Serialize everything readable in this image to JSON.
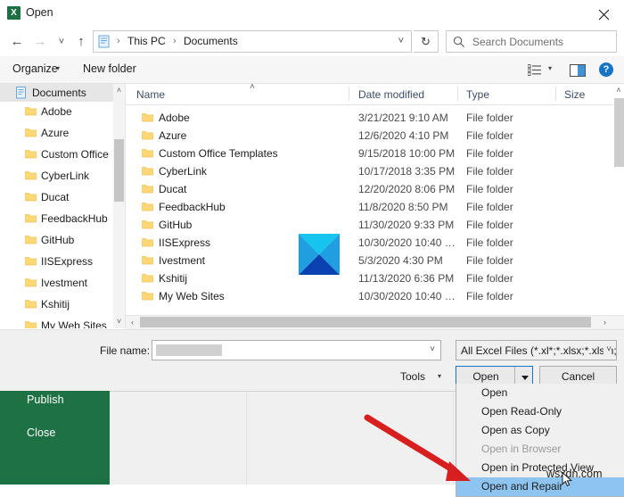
{
  "window": {
    "title": "Open",
    "app_icon": "excel-icon",
    "close_icon": "close-icon"
  },
  "nav": {
    "back_icon": "back-arrow-icon",
    "forward_icon": "forward-arrow-icon",
    "recent_icon": "recent-locations-chevron-icon",
    "up_icon": "up-arrow-icon",
    "breadcrumbs": [
      "This PC",
      "Documents"
    ],
    "separator": "›",
    "address_chevron": "chevron-down-icon",
    "refresh_icon": "refresh-icon"
  },
  "search": {
    "placeholder": "Search Documents",
    "icon": "search-icon"
  },
  "commandbar": {
    "organize_label": "Organize",
    "organize_caret": "▾",
    "new_folder_label": "New folder",
    "view_icon": "view-layout-icon",
    "view_caret": "▾",
    "preview_pane_icon": "preview-pane-icon",
    "help_icon": "help-icon"
  },
  "navpane": {
    "root": {
      "label": "Documents",
      "icon": "documents-folder-icon"
    },
    "items": [
      {
        "label": "Adobe"
      },
      {
        "label": "Azure"
      },
      {
        "label": "Custom Office"
      },
      {
        "label": "CyberLink"
      },
      {
        "label": "Ducat"
      },
      {
        "label": "FeedbackHub"
      },
      {
        "label": "GitHub"
      },
      {
        "label": "IISExpress"
      },
      {
        "label": "Ivestment"
      },
      {
        "label": "Kshitij"
      },
      {
        "label": "My Web Sites"
      }
    ],
    "scroll_up_icon": "chevron-up-icon",
    "scroll_down_icon": "chevron-down-icon"
  },
  "filelist": {
    "columns": [
      "Name",
      "Date modified",
      "Type",
      "Size"
    ],
    "sort_indicator": "˄",
    "rows": [
      {
        "name": "Adobe",
        "date": "3/21/2021 9:10 AM",
        "type": "File folder",
        "size": ""
      },
      {
        "name": "Azure",
        "date": "12/6/2020 4:10 PM",
        "type": "File folder",
        "size": ""
      },
      {
        "name": "Custom Office Templates",
        "date": "9/15/2018 10:00 PM",
        "type": "File folder",
        "size": ""
      },
      {
        "name": "CyberLink",
        "date": "10/17/2018 3:35 PM",
        "type": "File folder",
        "size": ""
      },
      {
        "name": "Ducat",
        "date": "12/20/2020 8:06 PM",
        "type": "File folder",
        "size": ""
      },
      {
        "name": "FeedbackHub",
        "date": "11/8/2020 8:50 PM",
        "type": "File folder",
        "size": ""
      },
      {
        "name": "GitHub",
        "date": "11/30/2020 9:33 PM",
        "type": "File folder",
        "size": ""
      },
      {
        "name": "IISExpress",
        "date": "10/30/2020 10:40 …",
        "type": "File folder",
        "size": ""
      },
      {
        "name": "Ivestment",
        "date": "5/3/2020 4:30 PM",
        "type": "File folder",
        "size": ""
      },
      {
        "name": "Kshitij",
        "date": "11/13/2020 6:36 PM",
        "type": "File folder",
        "size": ""
      },
      {
        "name": "My Web Sites",
        "date": "10/30/2020 10:40 …",
        "type": "File folder",
        "size": ""
      }
    ],
    "scroll_up_icon": "chevron-up-icon",
    "scroll_down_icon": "chevron-down-icon",
    "hscroll_left_icon": "chevron-left-icon",
    "hscroll_right_icon": "chevron-right-icon"
  },
  "bottom": {
    "filename_label": "File name:",
    "filename_value": "",
    "filename_chevron": "chevron-down-icon",
    "filter_value": "All Excel Files (*.xl*;*.xlsx;*.xlsm;",
    "filter_chevron": "chevron-down-icon",
    "tools_label": "Tools",
    "tools_caret": "▾",
    "open_label": "Open",
    "open_split_icon": "dropdown-arrow-icon",
    "cancel_label": "Cancel"
  },
  "open_menu": {
    "items": [
      {
        "label": "Open",
        "state": "normal"
      },
      {
        "label": "Open Read-Only",
        "state": "normal"
      },
      {
        "label": "Open as Copy",
        "state": "normal"
      },
      {
        "label": "Open in Browser",
        "state": "disabled"
      },
      {
        "label": "Open in Protected View",
        "state": "normal"
      },
      {
        "label": "Open and Repair",
        "state": "highlight"
      }
    ]
  },
  "backstage": {
    "items": [
      "Publish",
      "Close"
    ],
    "accent_color": "#1e7145"
  },
  "overlay": {
    "watermark": "wsxdn.com",
    "arrow_color": "#d81f1f",
    "cursor_icon": "mouse-pointer-icon",
    "graphic": "blue-x-square-icon"
  },
  "colors": {
    "accent_blue": "#1673c5",
    "menu_highlight": "#8ec5f0",
    "folder_yellow": "#fbd775",
    "excel_green": "#1d7044"
  }
}
